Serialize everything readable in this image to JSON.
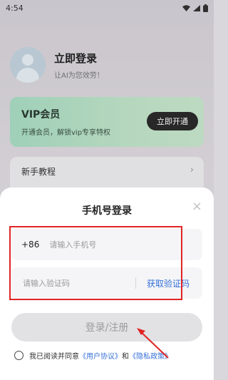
{
  "status_bar": {
    "time": "4:54"
  },
  "profile": {
    "title": "立即登录",
    "subtitle": "让AI为您效劳！"
  },
  "vip": {
    "title": "VIP会员",
    "subtitle": "开通会员，解锁vip专享特权",
    "button": "立即开通"
  },
  "menu": {
    "tutorial": "新手教程",
    "chevron": "›"
  },
  "sheet": {
    "title": "手机号登录",
    "close": "×",
    "country_code": "+86",
    "phone_placeholder": "请输入手机号",
    "code_placeholder": "请输入验证码",
    "get_code": "获取验证码",
    "login_button": "登录/注册",
    "agree_prefix": "我已阅读并同意",
    "user_agreement": "《用户协议》",
    "and": "和",
    "privacy_policy": "《隐私政策》"
  },
  "colors": {
    "accent": "#3570d8",
    "annotation_red": "#e02424",
    "vip_green": "#a8dcc2"
  }
}
